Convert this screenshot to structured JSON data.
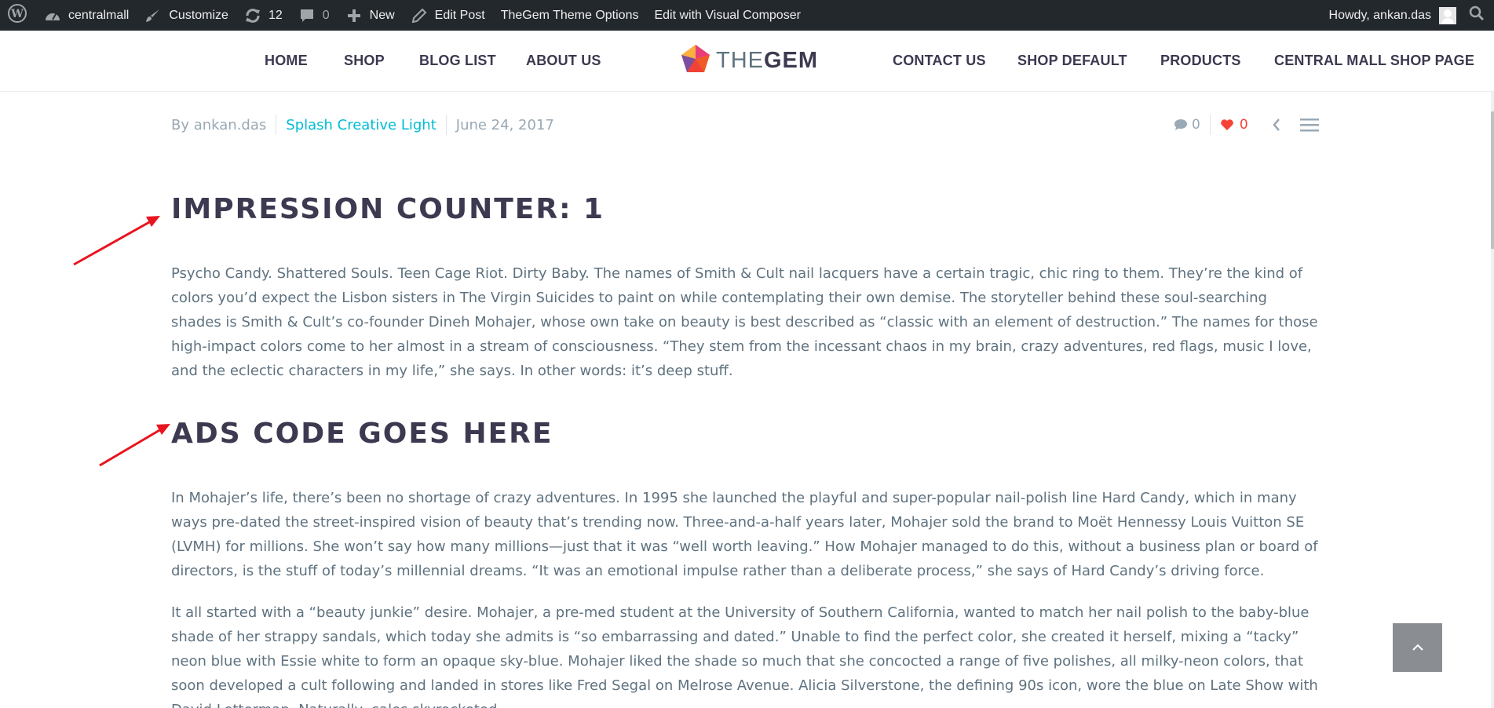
{
  "adminbar": {
    "site_name": "centralmall",
    "customize": "Customize",
    "updates_count": "12",
    "comments_count": "0",
    "new_label": "New",
    "edit_post": "Edit Post",
    "theme_options": "TheGem Theme Options",
    "visual_composer": "Edit with Visual Composer",
    "howdy": "Howdy, ankan.das"
  },
  "nav": {
    "left": [
      "HOME",
      "SHOP",
      "BLOG LIST",
      "ABOUT US"
    ],
    "right": [
      "CONTACT US",
      "SHOP DEFAULT",
      "PRODUCTS",
      "CENTRAL MALL SHOP PAGE"
    ],
    "logo_light": "THE",
    "logo_bold": "GEM"
  },
  "meta": {
    "author": "By ankan.das",
    "category": "Splash Creative Light",
    "date": "June 24, 2017",
    "comments": "0",
    "likes": "0"
  },
  "article": {
    "heading1": "IMPRESSION COUNTER: 1",
    "para1": "Psycho Candy. Shattered Souls. Teen Cage Riot. Dirty Baby. The names of Smith & Cult nail lacquers have a certain tragic, chic ring to them. They’re the kind of colors you’d expect the Lisbon sisters in The Virgin Suicides to paint on while contemplating their own demise. The storyteller behind these soul-searching shades is Smith & Cult’s co-founder Dineh Mohajer, whose own take on beauty is best described as “classic with an element of destruction.” The names for those high-impact colors come to her almost in a stream of consciousness. “They stem from the incessant chaos in my brain, crazy adventures, red flags, music I love, and the eclectic characters in my life,” she says. In other words: it’s deep stuff.",
    "heading2": "ADS CODE GOES HERE",
    "para2": "In Mohajer’s life, there’s been no shortage of crazy adventures. In 1995 she launched the playful and super-popular nail-polish line Hard Candy, which in many ways pre-dated the street-inspired vision of beauty that’s trending now. Three-and-a-half years later, Mohajer sold the brand to Moët Hennessy Louis Vuitton SE (LVMH) for millions. She won’t say how many millions—just that it was “well worth leaving.” How Mohajer managed to do this, without a business plan or board of directors, is the stuff of today’s millennial dreams. “It was an emotional impulse rather than a deliberate process,” she says of Hard Candy’s driving force.",
    "para3": "It all started with a “beauty junkie” desire. Mohajer, a pre-med student at the University of Southern California, wanted to match her nail polish to the baby-blue shade of her strappy sandals, which today she admits is “so embarrassing and dated.” Unable to find the perfect color, she created it herself, mixing a “tacky” neon blue with Essie white to form an opaque sky-blue. Mohajer liked the shade so much that she concocted a range of five polishes, all milky-neon colors, that soon developed a cult following and landed in stores like Fred Segal on Melrose Avenue. Alicia Silverstone, the defining 90s icon, wore the blue on Late Show with David Letterman. Naturally, sales skyrocketed."
  },
  "colors": {
    "adminbar_bg": "#23282d",
    "heading": "#3c3950",
    "body_text": "#5f727f",
    "accent": "#00bcd4",
    "like": "#f44336",
    "annotation_arrow": "#e8141e"
  }
}
